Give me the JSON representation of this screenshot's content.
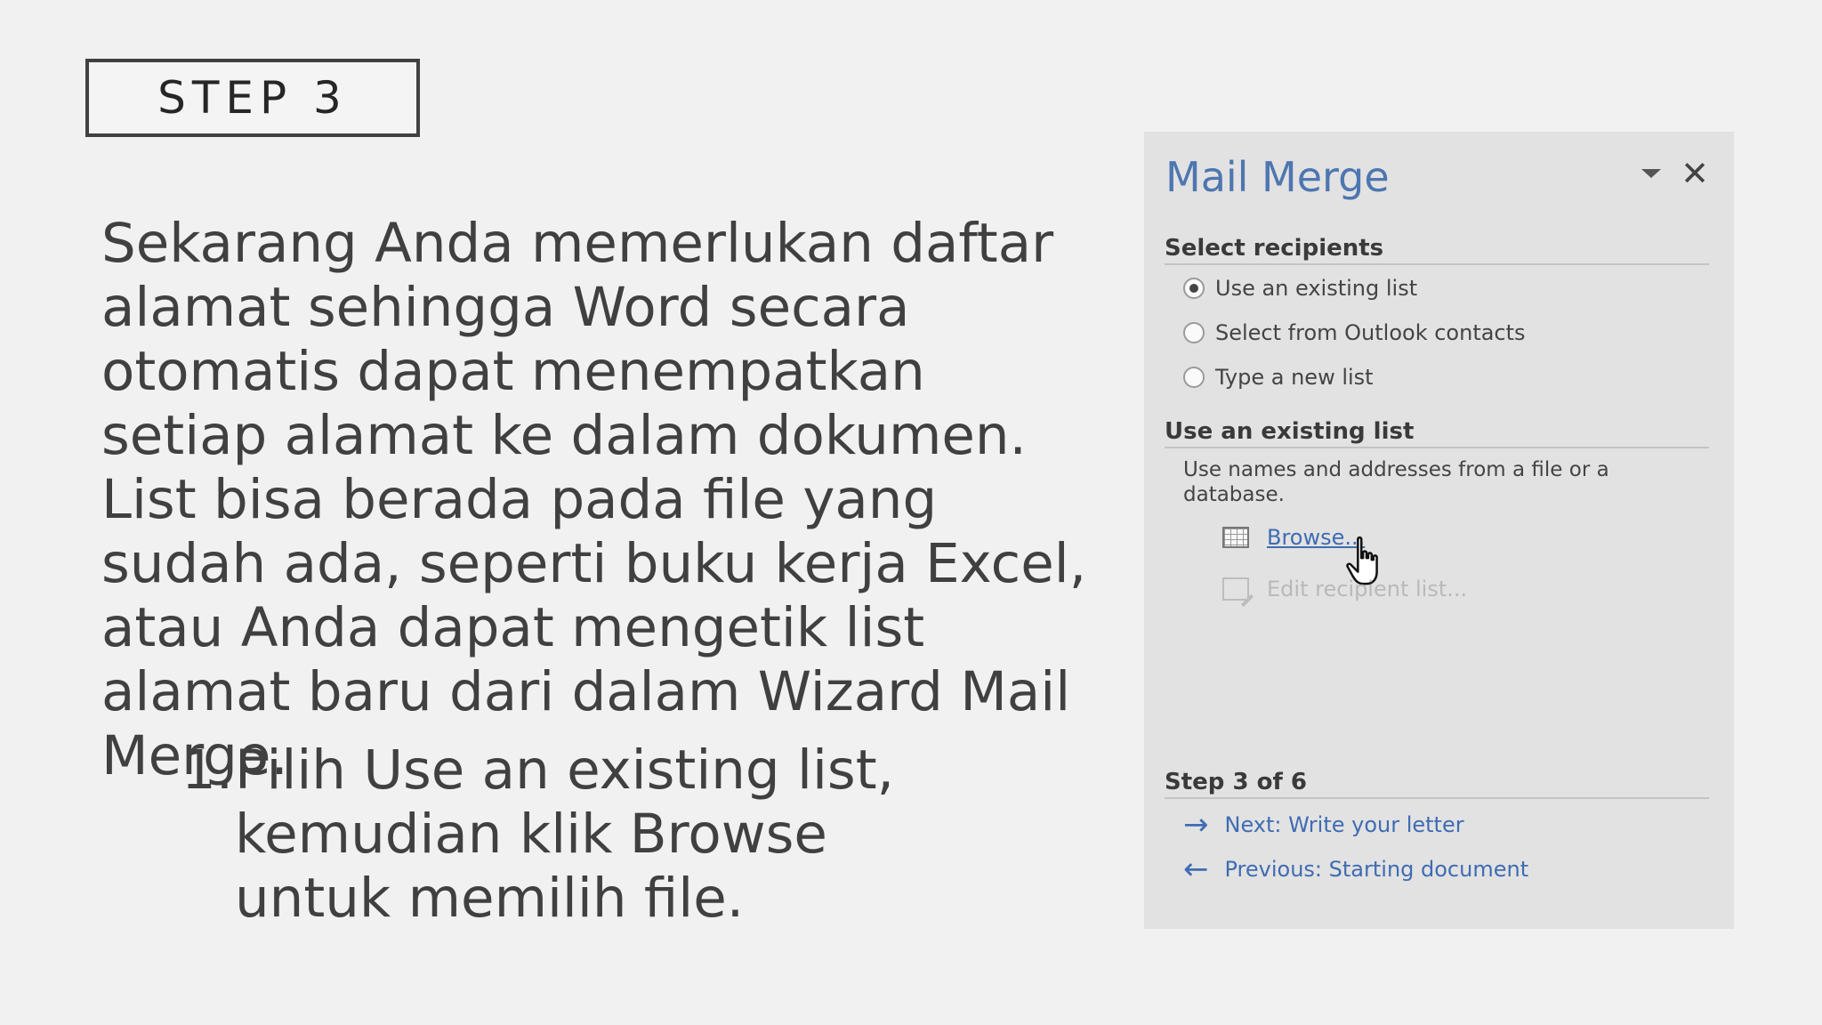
{
  "slide": {
    "step_label": "STEP 3",
    "paragraph": "Sekarang Anda memerlukan daftar alamat sehingga Word secara otomatis dapat menempatkan setiap alamat ke dalam dokumen. List bisa berada pada file yang sudah ada, seperti buku kerja Excel, atau Anda dapat mengetik list alamat baru dari dalam Wizard Mail Merge.",
    "list_items": [
      {
        "number": "1.",
        "text": "Pilih Use an existing list, kemudian klik Browse untuk memilih file."
      }
    ]
  },
  "panel": {
    "title": "Mail Merge",
    "select_recipients_heading": "Select recipients",
    "options": [
      {
        "label": "Use an existing list",
        "checked": true
      },
      {
        "label": "Select from Outlook contacts",
        "checked": false
      },
      {
        "label": "Type a new list",
        "checked": false
      }
    ],
    "existing_list_heading": "Use an existing list",
    "existing_list_description": "Use names and addresses from a file or a database.",
    "browse_label": "Browse...",
    "edit_label": "Edit recipient list...",
    "step_heading": "Step 3 of 6",
    "next_label": "Next: Write your letter",
    "previous_label": "Previous: Starting document"
  },
  "colors": {
    "background": "#f1f1f1",
    "panel_background": "#e2e2e2",
    "title_blue": "#4e76b0",
    "link_blue": "#3f6cb3",
    "text": "#404040"
  },
  "icons": {
    "dropdown": "chevron-down-icon",
    "close": "close-icon",
    "browse": "table-icon",
    "edit": "edit-list-icon",
    "cursor": "hand-pointer-icon",
    "next": "arrow-right-icon",
    "previous": "arrow-left-icon"
  }
}
